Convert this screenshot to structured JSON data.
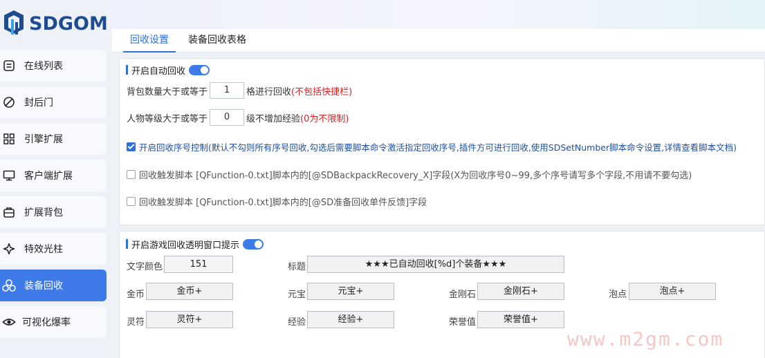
{
  "brand": {
    "name": "SDGOM"
  },
  "sidebar": {
    "items": [
      {
        "label": "在线列表",
        "icon": "list-icon",
        "active": false
      },
      {
        "label": "封后门",
        "icon": "block-icon",
        "active": false
      },
      {
        "label": "引擎扩展",
        "icon": "grid-icon",
        "active": false
      },
      {
        "label": "客户端扩展",
        "icon": "monitor-icon",
        "active": false
      },
      {
        "label": "扩展背包",
        "icon": "bag-icon",
        "active": false
      },
      {
        "label": "特效光柱",
        "icon": "sparkle-icon",
        "active": false
      },
      {
        "label": "装备回收",
        "icon": "recycle-icon",
        "active": true
      },
      {
        "label": "可视化爆率",
        "icon": "eye-icon",
        "active": false
      }
    ]
  },
  "tabs": [
    {
      "label": "回收设置",
      "active": true
    },
    {
      "label": "装备回收表格",
      "active": false
    }
  ],
  "auto_recycle": {
    "title": "开启自动回收",
    "enabled": true,
    "bag_count": {
      "prefix": "背包数量大于或等于",
      "value": "1",
      "suffix": "格进行回收",
      "note": "(不包括快捷栏)"
    },
    "level": {
      "prefix": "人物等级大于或等于",
      "value": "0",
      "suffix": "级不增加经验",
      "note": "(0为不限制)"
    },
    "options": [
      {
        "checked": true,
        "label": "开启回收序号控制(默认不勾则所有序号回收,勾选后需要脚本命令激活指定回收序号,插件方可进行回收,使用SDSetNumber脚本命令设置,详情查看脚本文档)"
      },
      {
        "checked": false,
        "label": "回收触发脚本 [QFunction-0.txt]脚本内的[@SDBackpackRecovery_X]字段(X为回收序号0~99,多个序号请写多个字段,不用请不要勾选)"
      },
      {
        "checked": false,
        "label": "回收触发脚本 [QFunction-0.txt]脚本内的[@SD准备回收单件反馈]字段"
      }
    ]
  },
  "popup": {
    "title": "开启游戏回收透明窗口提示",
    "enabled": true,
    "text_color": {
      "label": "文字颜色",
      "value": "151"
    },
    "heading": {
      "label": "标题",
      "value": "★★★已自动回收[%d]个装备★★★"
    },
    "fields": [
      {
        "label": "金币",
        "value": "金币+"
      },
      {
        "label": "元宝",
        "value": "元宝+"
      },
      {
        "label": "金刚石",
        "value": "金刚石+"
      },
      {
        "label": "泡点",
        "value": "泡点+"
      },
      {
        "label": "灵符",
        "value": "灵符+"
      },
      {
        "label": "经验",
        "value": "经验+"
      },
      {
        "label": "荣誉值",
        "value": "荣誉值+"
      }
    ]
  },
  "watermark": "www.m2gm.com",
  "colors": {
    "accent": "#3e7be8",
    "note_red": "#d42020",
    "brand_blue": "#1f4c8f"
  }
}
